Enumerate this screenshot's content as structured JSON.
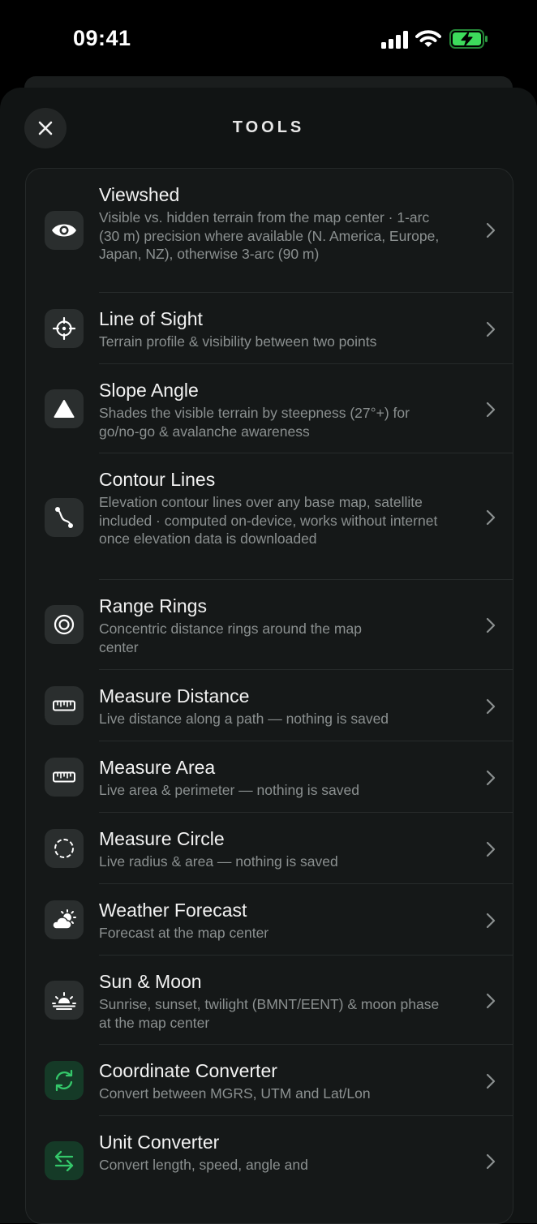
{
  "status_bar": {
    "time": "09:41",
    "battery_color": "#3ddc5c"
  },
  "header": {
    "title": "TOOLS",
    "close_icon": "close-icon"
  },
  "tools": [
    {
      "title": "Viewshed",
      "description": "Visible vs. hidden terrain from the map center · 1-arc (30 m) precision where available (N. America, Europe, Japan, NZ), otherwise 3-arc (90 m)",
      "icon": "eye-icon"
    },
    {
      "title": "Line of Sight",
      "description": "Terrain profile & visibility between two points",
      "icon": "crosshair-icon"
    },
    {
      "title": "Slope Angle",
      "description": "Shades the visible terrain by steepness (27°+) for go/no-go & avalanche awareness",
      "icon": "triangle-icon"
    },
    {
      "title": "Contour Lines",
      "description": "Elevation contour lines over any base map, satellite included · computed on-device, works without internet once elevation data is downloaded",
      "icon": "path-icon"
    },
    {
      "title": "Range Rings",
      "description": "Concentric distance rings around the map center",
      "icon": "rings-icon"
    },
    {
      "title": "Measure Distance",
      "description": "Live distance along a path — nothing is saved",
      "icon": "ruler-icon"
    },
    {
      "title": "Measure Area",
      "description": "Live area & perimeter — nothing is saved",
      "icon": "ruler-icon"
    },
    {
      "title": "Measure Circle",
      "description": "Live radius & area — nothing is saved",
      "icon": "dashed-circle-icon"
    },
    {
      "title": "Weather Forecast",
      "description": "Forecast at the map center",
      "icon": "cloud-sun-icon"
    },
    {
      "title": "Sun & Moon",
      "description": "Sunrise, sunset, twilight (BMNT/EENT) & moon phase at the map center",
      "icon": "sunrise-icon"
    },
    {
      "title": "Coordinate Converter",
      "description": "Convert between MGRS, UTM and Lat/Lon",
      "icon": "refresh-icon",
      "accent": "#34c76a"
    },
    {
      "title": "Unit Converter",
      "description": "Convert length, speed, angle and",
      "icon": "swap-arrows-icon",
      "accent": "#34c76a"
    }
  ]
}
